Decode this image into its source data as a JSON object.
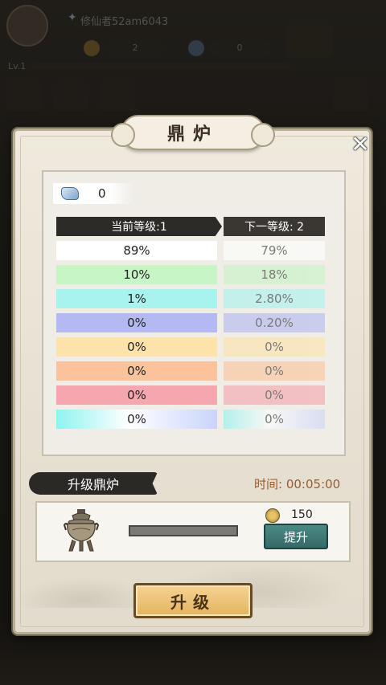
{
  "background": {
    "player_name": "修仙者52am6043",
    "coins": "2",
    "gems": "0",
    "level_label": "Lv.1"
  },
  "panel": {
    "title": "鼎炉",
    "close_icon": "close-x-icon",
    "gem_count": "0",
    "header_current": "当前等级:1",
    "header_next": "下一等级: 2",
    "rows": [
      {
        "current": "89%",
        "next": "79%",
        "color": "#ffffff"
      },
      {
        "current": "10%",
        "next": "18%",
        "color": "#c8f5c6"
      },
      {
        "current": "1%",
        "next": "2.80%",
        "color": "#a9f3ef"
      },
      {
        "current": "0%",
        "next": "0.20%",
        "color": "#b4b9f2"
      },
      {
        "current": "0%",
        "next": "0%",
        "color": "#fde3aa"
      },
      {
        "current": "0%",
        "next": "0%",
        "color": "#fbc39b"
      },
      {
        "current": "0%",
        "next": "0%",
        "color": "#f5a6ae"
      },
      {
        "current": "0%",
        "next": "0%",
        "color": "rainbow"
      }
    ],
    "upgrade_section": {
      "label": "升级鼎炉",
      "timer_label": "时间:",
      "timer_value": "00:05:00",
      "progress": 0.0,
      "cost": "150",
      "boost_button": "提升",
      "upgrade_button": "升级"
    }
  }
}
